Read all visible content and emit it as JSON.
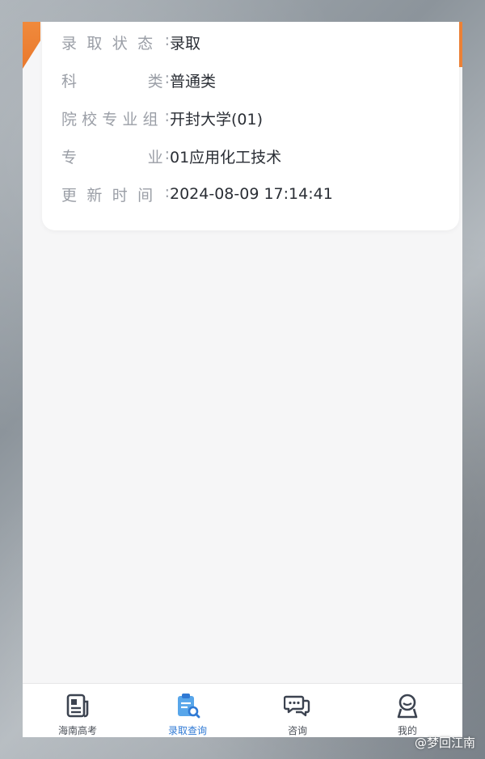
{
  "result": {
    "rows": [
      {
        "label_chars": [
          "录",
          "取",
          "状",
          "态"
        ],
        "value": "录取"
      },
      {
        "label_chars": [
          "科",
          "类"
        ],
        "value": "普通类"
      },
      {
        "label_chars": [
          "院",
          "校",
          "专",
          "业",
          "组"
        ],
        "value": "开封大学(01)"
      },
      {
        "label_chars": [
          "专",
          "业"
        ],
        "value": "01应用化工技术"
      },
      {
        "label_chars": [
          "更",
          "新",
          "时",
          "间"
        ],
        "value": "2024-08-09 17:14:41"
      }
    ],
    "colon": ":"
  },
  "tabbar": {
    "tabs": [
      {
        "label": "海南高考",
        "icon": "news-icon",
        "active": false
      },
      {
        "label": "录取查询",
        "icon": "clipboard-search-icon",
        "active": true
      },
      {
        "label": "咨询",
        "icon": "chat-icon",
        "active": false
      },
      {
        "label": "我的",
        "icon": "user-icon",
        "active": false
      }
    ]
  },
  "watermark": "@梦回江南",
  "colors": {
    "accent": "#ee8236",
    "active_tab": "#2f79d4",
    "label": "#9a9ea6",
    "value": "#2a2e35"
  }
}
